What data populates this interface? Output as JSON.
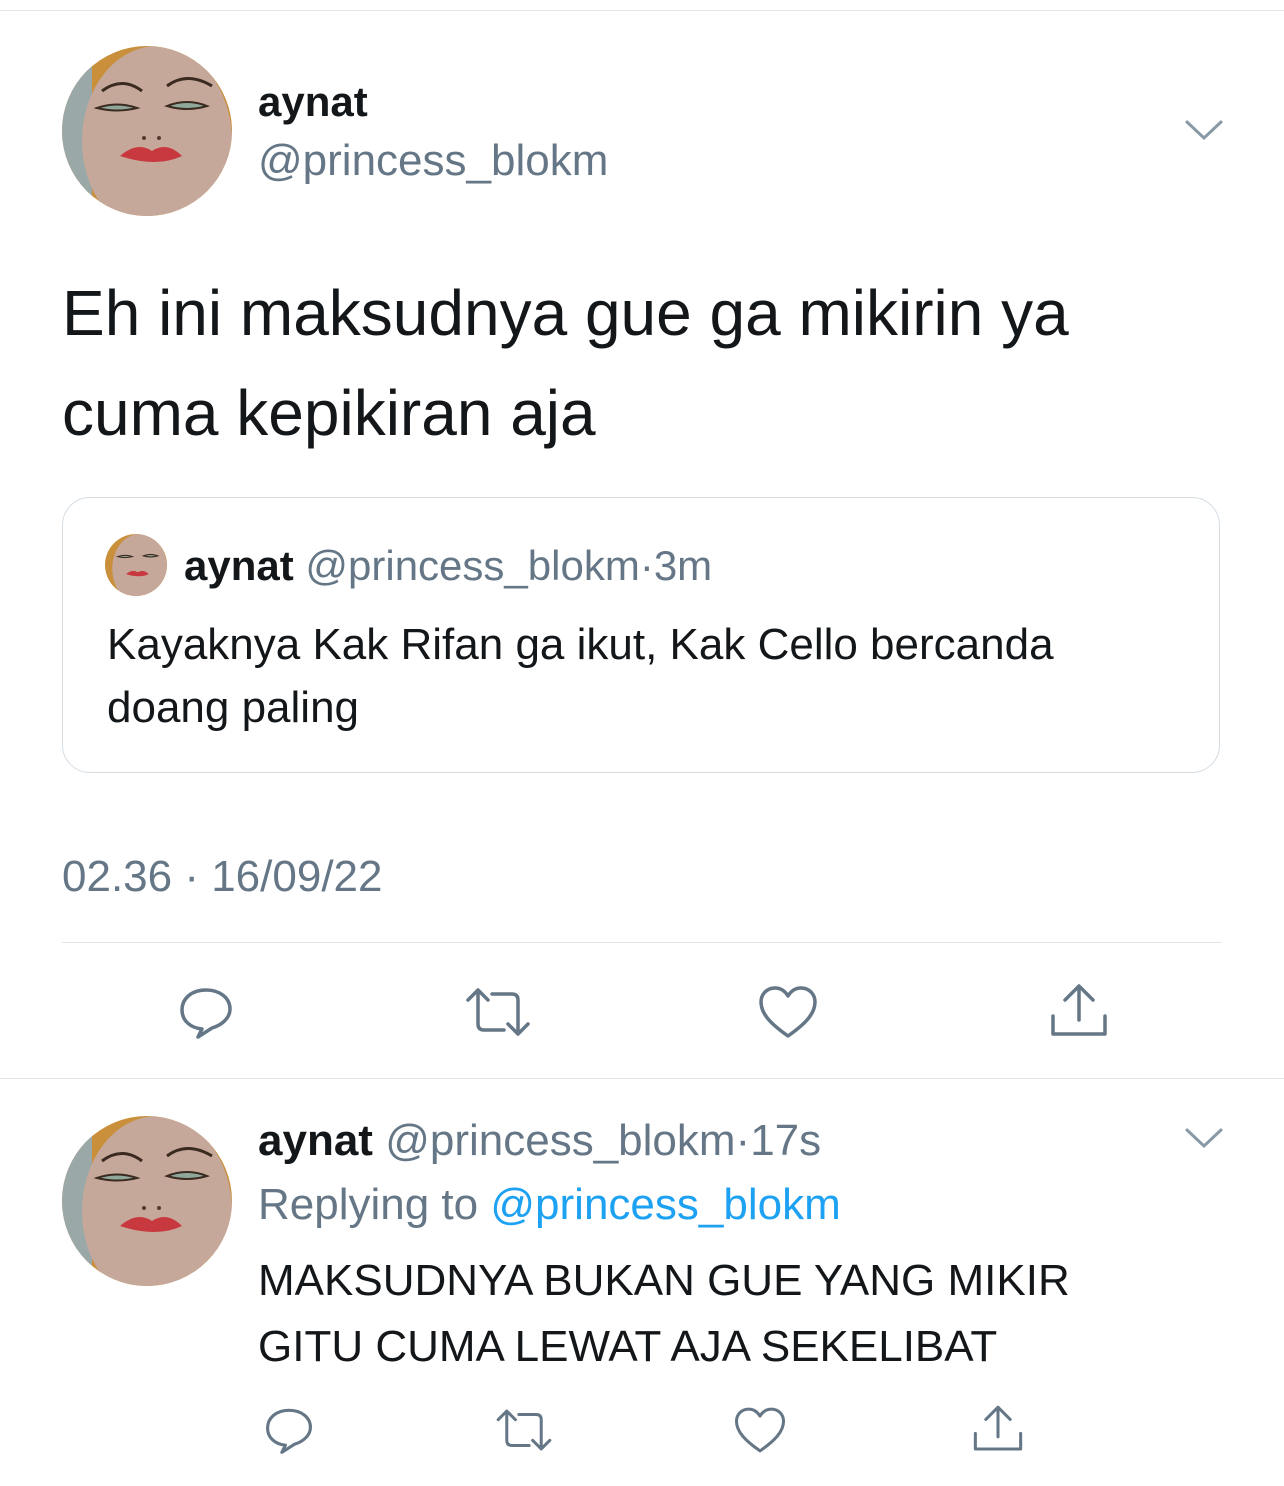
{
  "main_tweet": {
    "display_name": "aynat",
    "handle": "@princess_blokm",
    "text_lines": [
      "Eh ini maksudnya gue ga mikirin ya",
      "cuma kepikiran aja"
    ],
    "timestamp": "02.36 · 16/09/22",
    "quoted_tweet": {
      "display_name": "aynat",
      "handle": "@princess_blokm",
      "time": "3m",
      "text_lines": [
        "Kayaknya Kak Rifan ga ikut, Kak Cello bercanda",
        "doang paling"
      ]
    }
  },
  "reply_tweet": {
    "display_name": "aynat",
    "handle": "@princess_blokm",
    "time": "17s",
    "replying_label": "Replying to",
    "replying_handle": "@princess_blokm",
    "text_lines": [
      "MAKSUDNYA BUKAN GUE YANG MIKIR",
      "GITU CUMA LEWAT AJA SEKELIBAT"
    ]
  },
  "icons": {
    "reply": "reply-icon",
    "retweet": "retweet-icon",
    "like": "heart-icon",
    "share": "share-icon",
    "menu": "chevron-down-icon"
  },
  "colors": {
    "text": "#14171a",
    "secondary": "#657786",
    "link": "#1da1f2",
    "border": "#e1e8ed"
  }
}
